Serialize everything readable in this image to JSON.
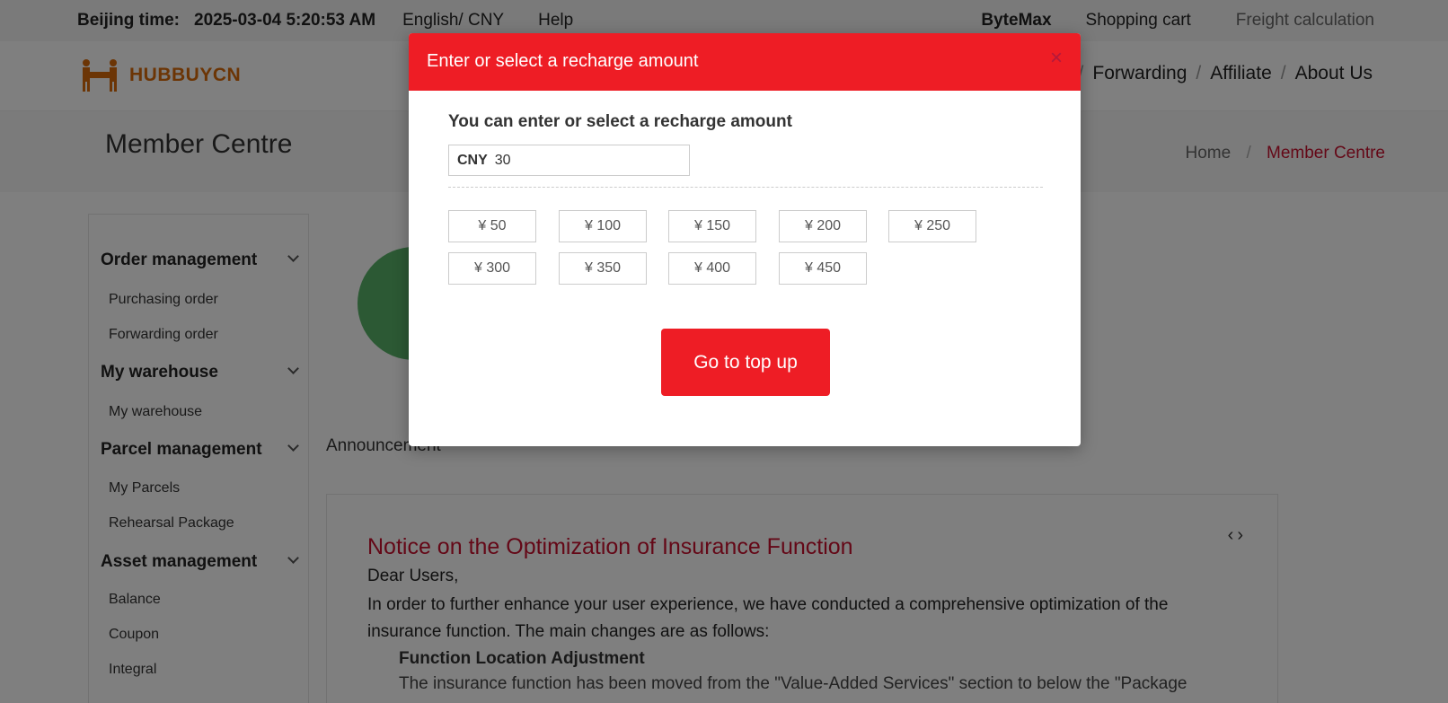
{
  "topbar": {
    "beijing_label": "Beijing time:",
    "beijing_value": "2025-03-04 5:20:53 AM",
    "language": "English/ CNY",
    "help": "Help",
    "username": "ByteMax",
    "cart": "Shopping cart",
    "freight": "Freight calculation"
  },
  "header": {
    "logo_text": "HUBBUYCN",
    "nav": [
      "uy",
      "Forwarding",
      "Affiliate",
      "About Us"
    ]
  },
  "title_strip": {
    "page_title": "Member Centre",
    "breadcrumb_home": "Home",
    "breadcrumb_current": "Member Centre"
  },
  "sidebar": {
    "groups": [
      {
        "title": "Order management",
        "items": [
          "Purchasing order",
          "Forwarding order"
        ]
      },
      {
        "title": "My warehouse",
        "items": [
          "My warehouse"
        ]
      },
      {
        "title": "Parcel management",
        "items": [
          "My Parcels",
          "Rehearsal Package"
        ]
      },
      {
        "title": "Asset management",
        "items": [
          "Balance",
          "Coupon",
          "Integral"
        ]
      }
    ]
  },
  "main": {
    "announcement_label": "Announcement",
    "notice": {
      "title": "Notice on the Optimization of Insurance Function",
      "greeting": "Dear Users,",
      "paragraph": "In order to further enhance your user experience, we have conducted a comprehensive optimization of the insurance function. The main changes are as follows:",
      "subheading": "Function Location Adjustment",
      "subtext": "The insurance function has been moved from the \"Value-Added Services\" section to below the \"Package"
    }
  },
  "modal": {
    "title": "Enter or select a recharge amount",
    "close": "×",
    "prompt": "You can enter or select a recharge amount",
    "currency": "CNY",
    "amount_value": "30",
    "presets": [
      "¥ 50",
      "¥ 100",
      "¥ 150",
      "¥ 200",
      "¥ 250",
      "¥ 300",
      "¥ 350",
      "¥ 400",
      "¥ 450"
    ],
    "submit": "Go to top up"
  },
  "colors": {
    "brand_red": "#ee1d25",
    "accent_red": "#c8102e",
    "logo_orange": "#d86a0b"
  }
}
